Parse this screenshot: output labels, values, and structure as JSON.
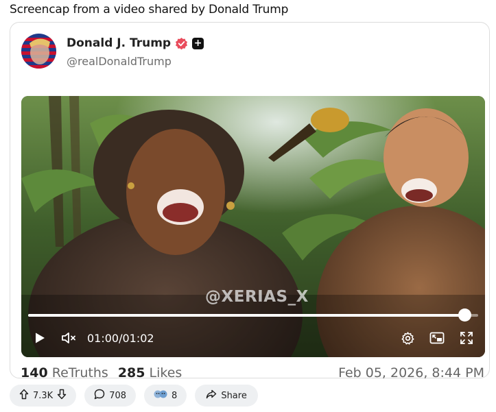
{
  "caption": "Screencap from a video shared by Donald Trump",
  "post": {
    "author_name": "Donald J. Trump",
    "handle": "@realDonaldTrump",
    "badge_plus": "+",
    "video": {
      "watermark": "@XERIAS_X",
      "time": "01:00/01:02",
      "progress": 0.97,
      "muted": true
    },
    "stats": {
      "retruths_count": "140",
      "retruths_label": "ReTruths",
      "likes_count": "285",
      "likes_label": "Likes"
    },
    "date": "Feb 05, 2026, 8:44 PM"
  },
  "actions": {
    "votes": "7.3K",
    "replies": "708",
    "reactions": "8",
    "share": "Share"
  },
  "colors": {
    "verified": "#e94c5c",
    "pill_bg": "#eef0f2",
    "muted_text": "#6d6d6d"
  }
}
